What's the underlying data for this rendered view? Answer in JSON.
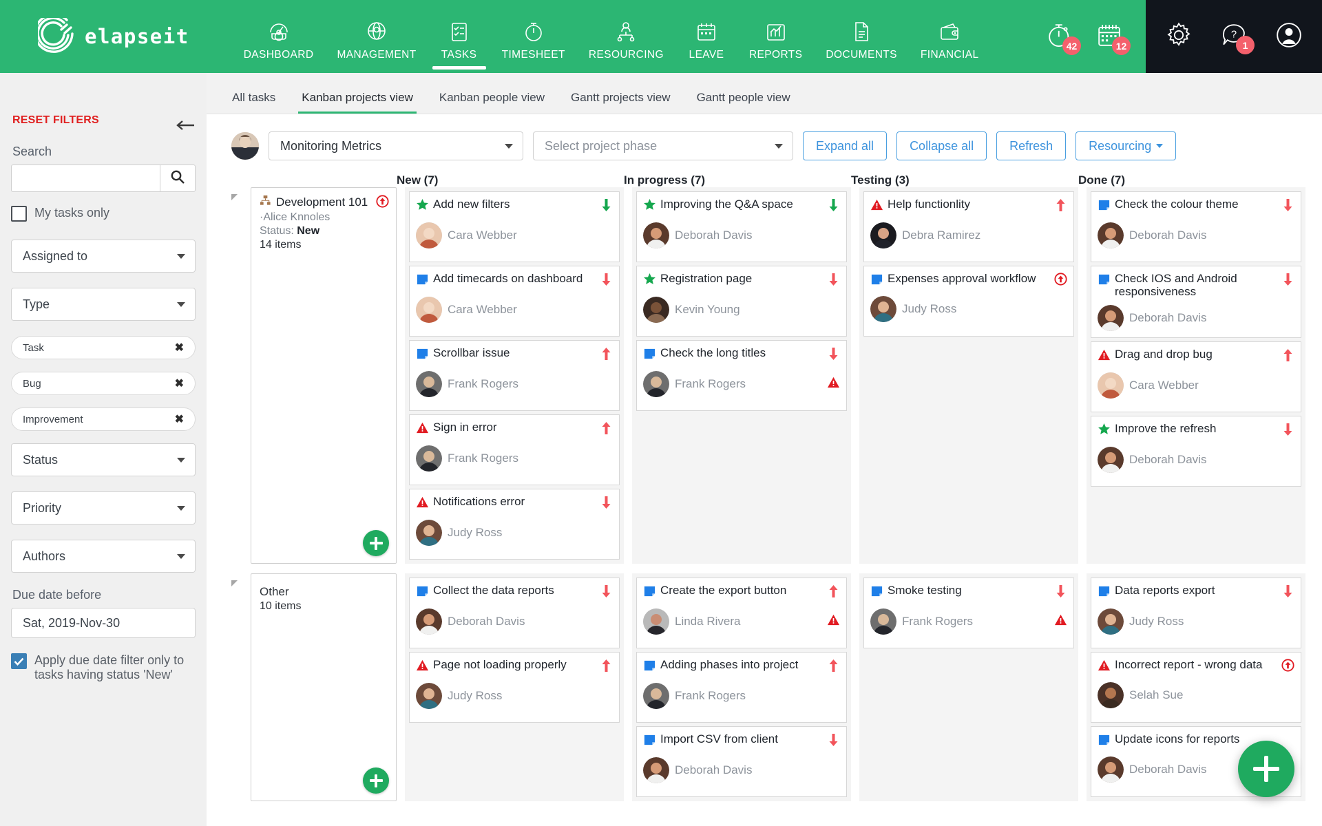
{
  "brand": {
    "name": "elapseit",
    "logo_icon": "elapseit-swirl-logo",
    "green": "#2cb673",
    "dark": "#11151c",
    "red": "#f4606c"
  },
  "topnav": {
    "items": [
      {
        "label": "DASHBOARD",
        "icon": "gauge-gear-icon",
        "active": false
      },
      {
        "label": "MANAGEMENT",
        "icon": "globe-person-icon",
        "active": false
      },
      {
        "label": "TASKS",
        "icon": "checklist-icon",
        "active": true
      },
      {
        "label": "TIMESHEET",
        "icon": "stopwatch-icon",
        "active": false
      },
      {
        "label": "RESOURCING",
        "icon": "person-network-icon",
        "active": false
      },
      {
        "label": "LEAVE",
        "icon": "calendar-icon",
        "active": false
      },
      {
        "label": "REPORTS",
        "icon": "bar-chart-icon",
        "active": false
      },
      {
        "label": "DOCUMENTS",
        "icon": "document-icon",
        "active": false
      },
      {
        "label": "FINANCIAL",
        "icon": "wallet-icon",
        "active": false
      }
    ],
    "timer": {
      "icon": "stopwatch-icon",
      "badge": "42"
    },
    "calendar": {
      "icon": "calendar-icon",
      "badge": "12"
    },
    "settings": {
      "icon": "gear-icon"
    },
    "help": {
      "icon": "question-bubble-icon",
      "badge": "1"
    },
    "profile": {
      "icon": "user-avatar-icon"
    }
  },
  "tabs": [
    {
      "label": "All tasks",
      "active": false
    },
    {
      "label": "Kanban projects view",
      "active": true
    },
    {
      "label": "Kanban people view",
      "active": false
    },
    {
      "label": "Gantt projects view",
      "active": false
    },
    {
      "label": "Gantt people view",
      "active": false
    }
  ],
  "sidebar": {
    "collapse_icon": "arrow-left-icon",
    "reset_filters": "RESET FILTERS",
    "search_label": "Search",
    "search_value": "",
    "search_placeholder": "",
    "search_icon": "search-icon",
    "my_tasks_only": {
      "label": "My tasks only",
      "checked": false
    },
    "assigned_to": "Assigned to",
    "type": "Type",
    "type_chips": [
      "Task",
      "Bug",
      "Improvement"
    ],
    "status": "Status",
    "priority": "Priority",
    "authors": "Authors",
    "due_date_label": "Due date before",
    "due_date_value": "Sat, 2019-Nov-30",
    "apply_due_date": {
      "label": "Apply due date filter only to tasks having status 'New'",
      "checked": true
    }
  },
  "toolbar": {
    "avatar_icon": "user-avatar-icon",
    "project": "Monitoring Metrics",
    "phase_placeholder": "Select project phase",
    "expand_all": "Expand all",
    "collapse_all": "Collapse all",
    "refresh": "Refresh",
    "resourcing": "Resourcing"
  },
  "columns": [
    {
      "title": "New (7)"
    },
    {
      "title": "In progress (7)"
    },
    {
      "title": "Testing (3)"
    },
    {
      "title": "Done (7)"
    }
  ],
  "groups": [
    {
      "name": "Development 101",
      "icon": "org-chart-icon",
      "owner": "Alice Knnoles",
      "status_label": "Status:",
      "status_value": "New",
      "items": "14 items",
      "urgent_icon": "urgent-arrow-icon",
      "add_icon": "plus-icon",
      "cards": {
        "new": [
          {
            "title": "Add new filters",
            "type": "improvement",
            "priority": "low",
            "assignee": "Cara Webber",
            "avatar": "avatar-cara",
            "alert": false
          },
          {
            "title": "Add timecards on dashboard",
            "type": "task",
            "priority": "lowest",
            "assignee": "Cara Webber",
            "avatar": "avatar-cara",
            "alert": false
          },
          {
            "title": "Scrollbar issue",
            "type": "task",
            "priority": "high",
            "assignee": "Frank Rogers",
            "avatar": "avatar-frank",
            "alert": false
          },
          {
            "title": "Sign in error",
            "type": "bug",
            "priority": "high",
            "assignee": "Frank Rogers",
            "avatar": "avatar-frank",
            "alert": false
          },
          {
            "title": "Notifications error",
            "type": "bug",
            "priority": "lowest",
            "assignee": "Judy Ross",
            "avatar": "avatar-judy",
            "alert": false
          }
        ],
        "in_progress": [
          {
            "title": "Improving the Q&A space",
            "type": "improvement",
            "priority": "low",
            "assignee": "Deborah Davis",
            "avatar": "avatar-deborah",
            "alert": false
          },
          {
            "title": "Registration page",
            "type": "improvement",
            "priority": "lowest",
            "assignee": "Kevin Young",
            "avatar": "avatar-kevin",
            "alert": false
          },
          {
            "title": "Check the long titles",
            "type": "task",
            "priority": "lowest",
            "assignee": "Frank Rogers",
            "avatar": "avatar-frank",
            "alert": true
          }
        ],
        "testing": [
          {
            "title": "Help functionlity",
            "type": "bug",
            "priority": "high",
            "assignee": "Debra Ramirez",
            "avatar": "avatar-debra",
            "alert": false
          },
          {
            "title": "Expenses approval workflow",
            "type": "task",
            "priority": "urgent",
            "assignee": "Judy Ross",
            "avatar": "avatar-judy",
            "alert": false
          }
        ],
        "done": [
          {
            "title": "Check the colour theme",
            "type": "task",
            "priority": "lowest",
            "assignee": "Deborah Davis",
            "avatar": "avatar-deborah",
            "alert": false
          },
          {
            "title": "Check IOS and Android responsiveness",
            "type": "task",
            "priority": "lowest",
            "assignee": "Deborah Davis",
            "avatar": "avatar-deborah",
            "alert": false
          },
          {
            "title": "Drag and drop bug",
            "type": "bug",
            "priority": "high",
            "assignee": "Cara Webber",
            "avatar": "avatar-cara",
            "alert": false
          },
          {
            "title": "Improve the refresh",
            "type": "improvement",
            "priority": "lowest",
            "assignee": "Deborah Davis",
            "avatar": "avatar-deborah",
            "alert": false
          }
        ]
      }
    },
    {
      "name": "Other",
      "icon": "",
      "owner": "",
      "status_label": "",
      "status_value": "",
      "items": "10 items",
      "urgent_icon": "",
      "add_icon": "plus-icon",
      "cards": {
        "new": [
          {
            "title": "Collect the data reports",
            "type": "task",
            "priority": "lowest",
            "assignee": "Deborah Davis",
            "avatar": "avatar-deborah",
            "alert": false
          },
          {
            "title": "Page not loading properly",
            "type": "bug",
            "priority": "high",
            "assignee": "Judy Ross",
            "avatar": "avatar-judy",
            "alert": false
          }
        ],
        "in_progress": [
          {
            "title": "Create the export button",
            "type": "task",
            "priority": "high",
            "assignee": "Linda Rivera",
            "avatar": "avatar-linda",
            "alert": true
          },
          {
            "title": "Adding phases into project",
            "type": "task",
            "priority": "high",
            "assignee": "Frank Rogers",
            "avatar": "avatar-frank",
            "alert": false
          },
          {
            "title": "Import CSV from client",
            "type": "task",
            "priority": "lowest",
            "assignee": "Deborah Davis",
            "avatar": "avatar-deborah",
            "alert": false
          }
        ],
        "testing": [
          {
            "title": "Smoke testing",
            "type": "task",
            "priority": "lowest",
            "assignee": "Frank Rogers",
            "avatar": "avatar-frank",
            "alert": true
          }
        ],
        "done": [
          {
            "title": "Data reports export",
            "type": "task",
            "priority": "lowest",
            "assignee": "Judy Ross",
            "avatar": "avatar-judy",
            "alert": false
          },
          {
            "title": "Incorrect report - wrong data",
            "type": "bug",
            "priority": "urgent",
            "assignee": "Selah Sue",
            "avatar": "avatar-selah",
            "alert": false
          },
          {
            "title": "Update icons for reports",
            "type": "task",
            "priority": "",
            "assignee": "Deborah Davis",
            "avatar": "avatar-deborah",
            "alert": false
          }
        ]
      }
    }
  ],
  "fab": {
    "icon": "plus-icon"
  }
}
